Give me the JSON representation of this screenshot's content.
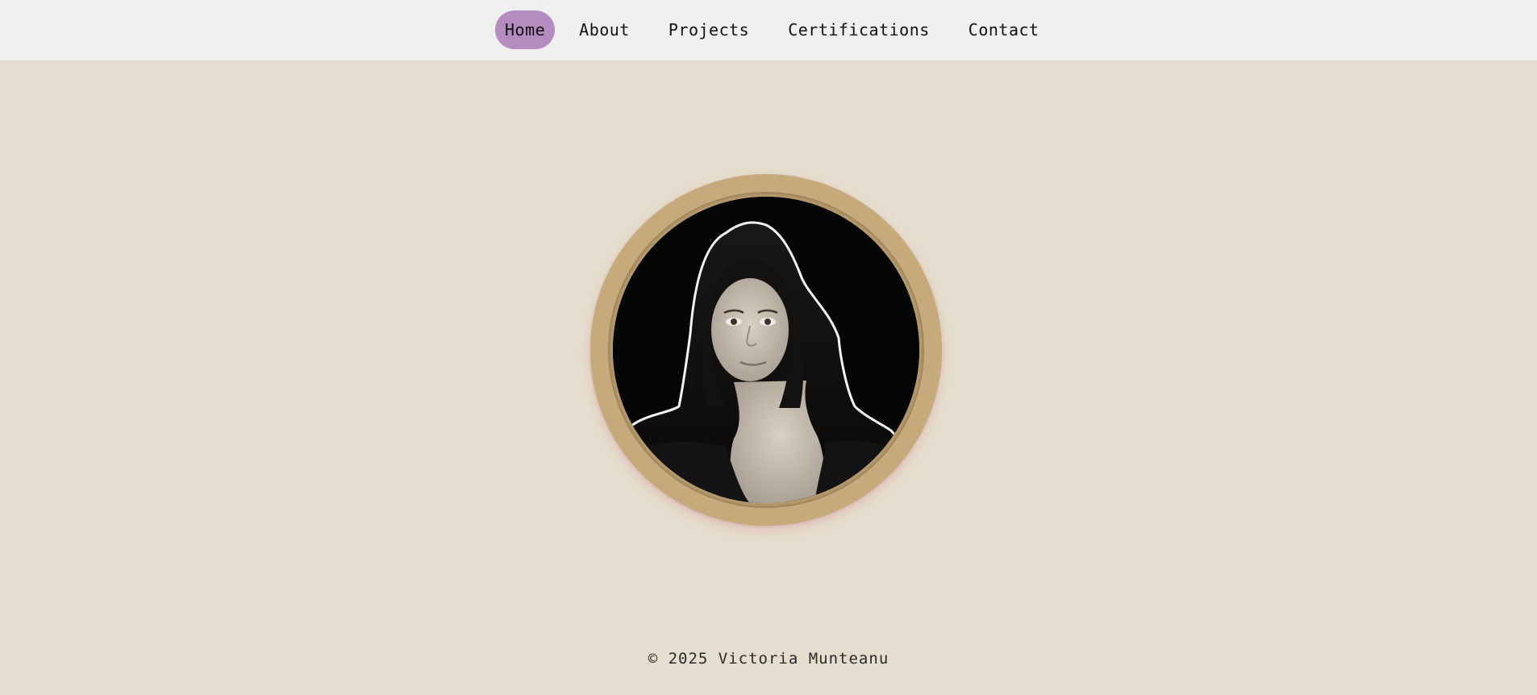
{
  "nav": {
    "items": [
      {
        "label": "Home",
        "active": true
      },
      {
        "label": "About",
        "active": false
      },
      {
        "label": "Projects",
        "active": false
      },
      {
        "label": "Certifications",
        "active": false
      },
      {
        "label": "Contact",
        "active": false
      }
    ]
  },
  "hero": {
    "image": "profile-portrait-photo"
  },
  "footer": {
    "copyright": "© 2025 Victoria Munteanu"
  },
  "colors": {
    "page_background": "#e5ddcd",
    "nav_background": "#f0f0f0",
    "active_pill": "#b58cbf",
    "portrait_frame": "#c6aa7b"
  }
}
